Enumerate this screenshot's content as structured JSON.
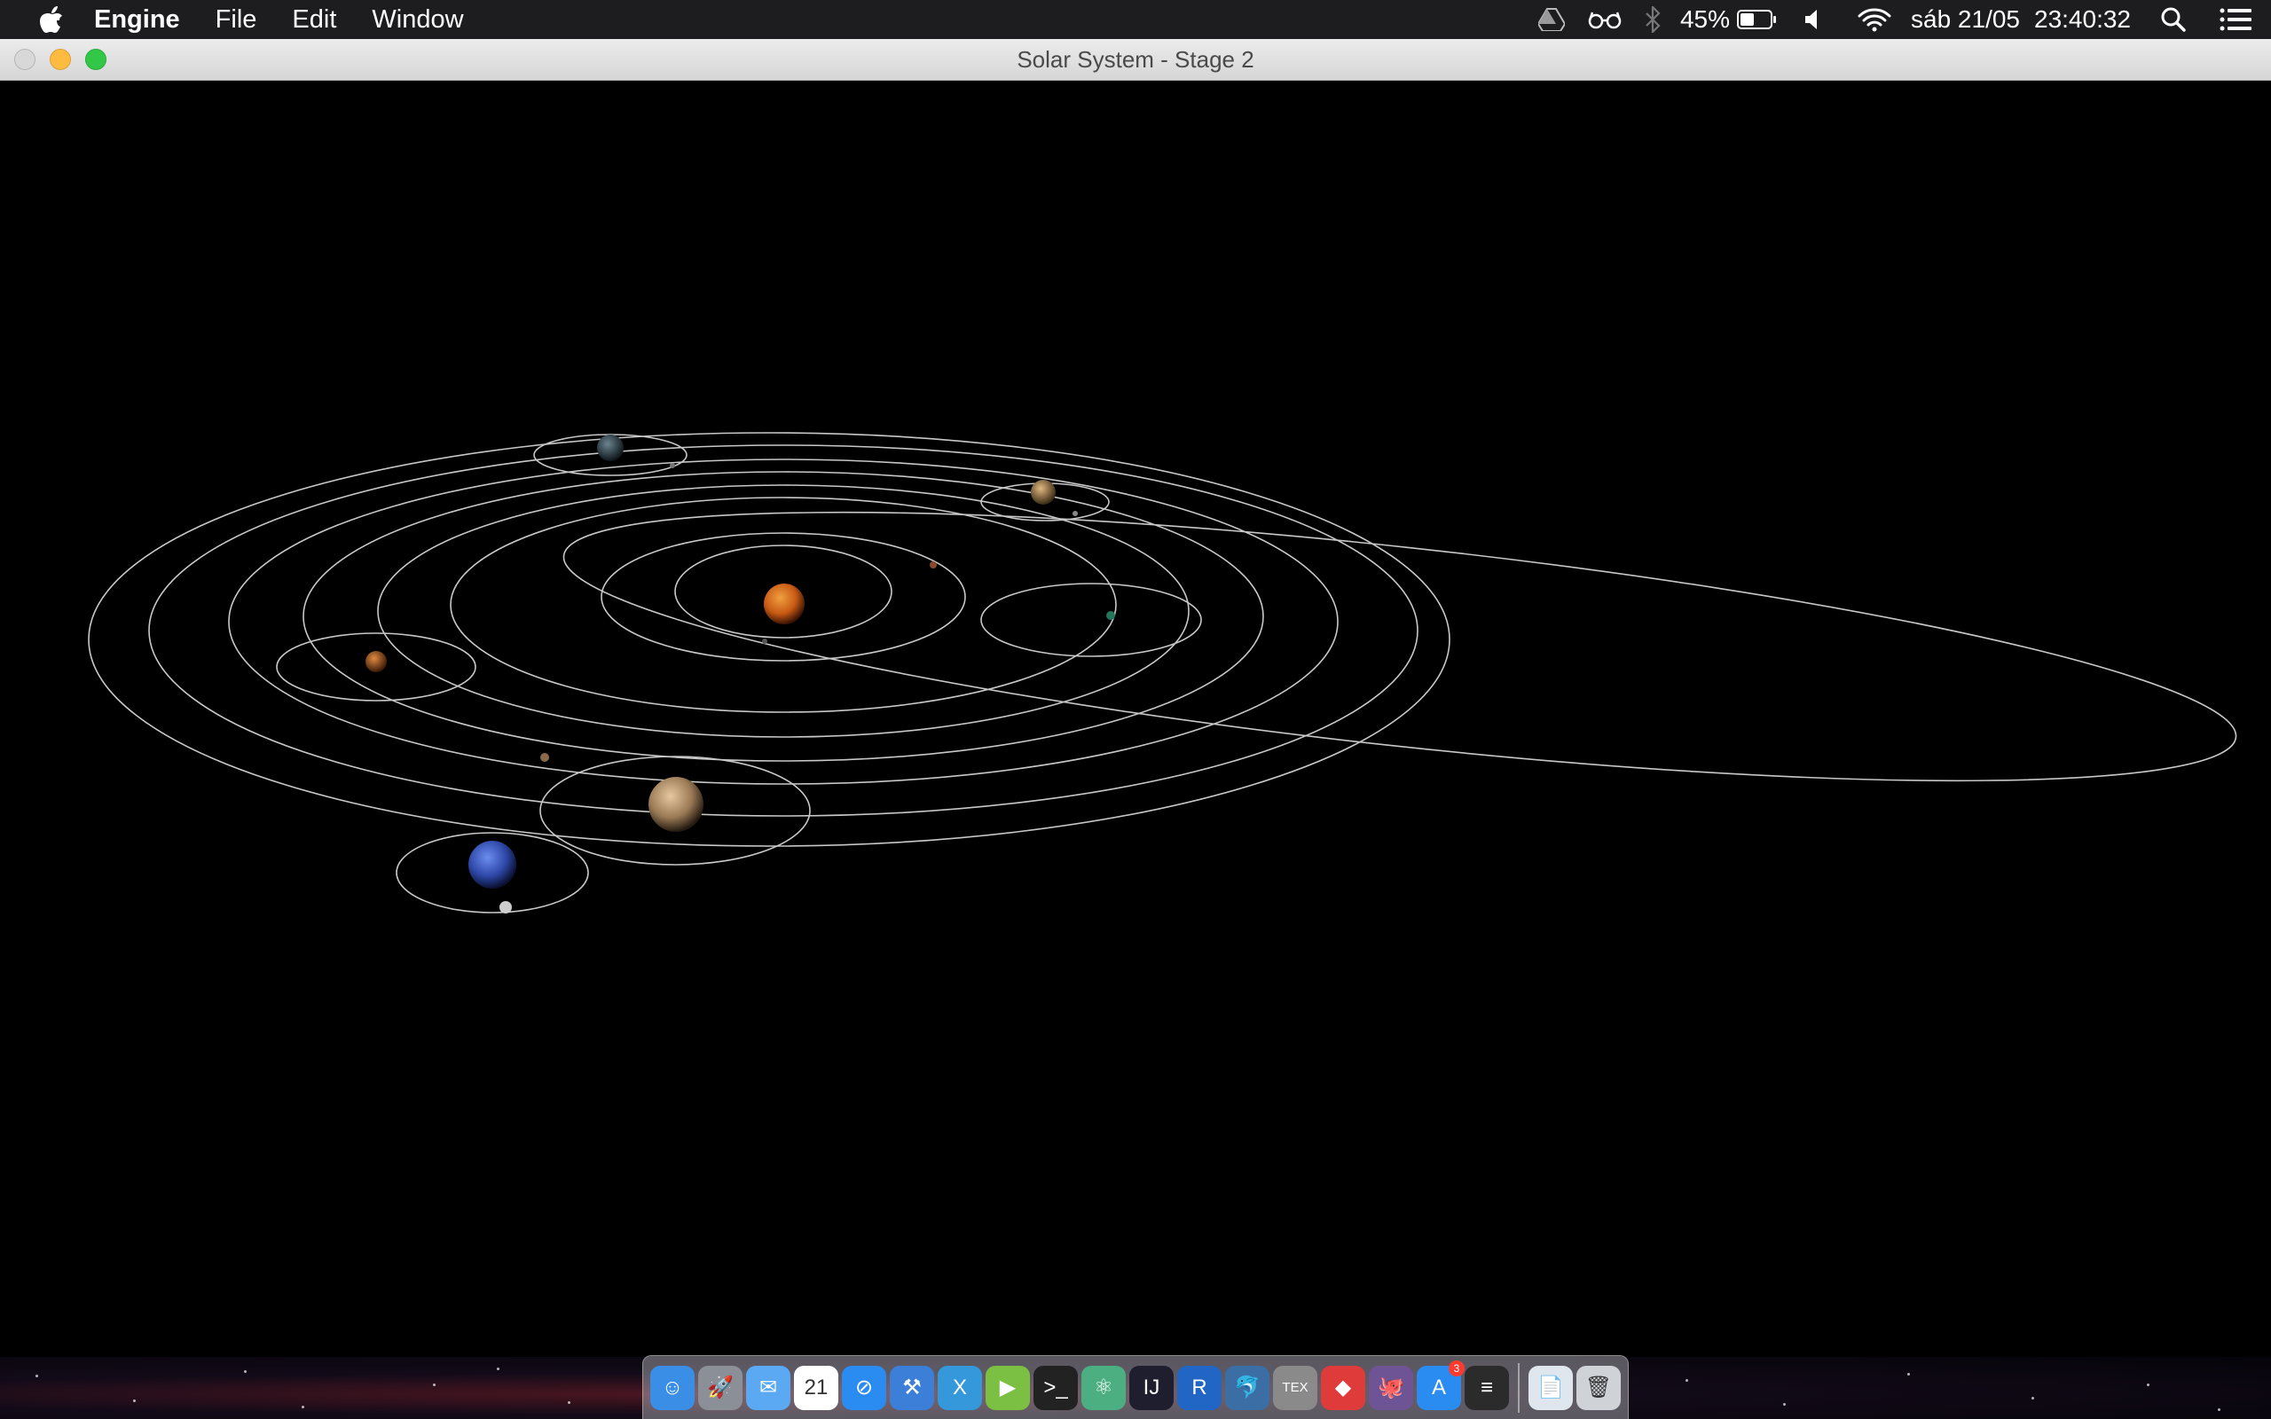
{
  "menubar": {
    "app_name": "Engine",
    "menus": [
      "File",
      "Edit",
      "Window"
    ],
    "status": {
      "battery": "45%",
      "date": "sáb 21/05",
      "time": "23:40:32"
    }
  },
  "window": {
    "title": "Solar System - Stage 2"
  },
  "dock": {
    "items": [
      {
        "name": "finder-icon",
        "color": "#3a8ee6",
        "glyph": "☺"
      },
      {
        "name": "launchpad-icon",
        "color": "#8a8f98",
        "glyph": "🚀"
      },
      {
        "name": "mail-icon",
        "color": "#5aa9f2",
        "glyph": "✉"
      },
      {
        "name": "calendar-icon",
        "color": "#ffffff",
        "glyph": "21"
      },
      {
        "name": "safari-icon",
        "color": "#2a8cf0",
        "glyph": "⊘"
      },
      {
        "name": "xcode-instruments-icon",
        "color": "#3b7fd8",
        "glyph": "⚒"
      },
      {
        "name": "xamarin-icon",
        "color": "#3498db",
        "glyph": "X"
      },
      {
        "name": "infuse-icon",
        "color": "#7bc043",
        "glyph": "▶"
      },
      {
        "name": "terminal-icon",
        "color": "#222222",
        "glyph": ">_"
      },
      {
        "name": "atom-icon",
        "color": "#4caf82",
        "glyph": "⚛"
      },
      {
        "name": "intellij-icon",
        "color": "#1e1e2e",
        "glyph": "IJ"
      },
      {
        "name": "r-icon",
        "color": "#2166c4",
        "glyph": "R"
      },
      {
        "name": "mysql-workbench-icon",
        "color": "#3c6ea6",
        "glyph": "🐬"
      },
      {
        "name": "tex-icon",
        "color": "#8a8a8a",
        "glyph": "TEX"
      },
      {
        "name": "git-icon",
        "color": "#e03b3b",
        "glyph": "◆"
      },
      {
        "name": "github-icon",
        "color": "#6e5494",
        "glyph": "🐙"
      },
      {
        "name": "app-store-icon",
        "color": "#2a8cf0",
        "glyph": "A",
        "badge": "3"
      },
      {
        "name": "console-icon",
        "color": "#2b2b2b",
        "glyph": "≡"
      }
    ],
    "right_items": [
      {
        "name": "document-preview-icon",
        "color": "#dfe6ee",
        "glyph": "📄"
      },
      {
        "name": "trash-icon",
        "color": "#cfd3d8",
        "glyph": "🗑"
      }
    ]
  },
  "colors": {
    "orbit": "#c8c8c8",
    "sun": "#d9661a",
    "saturn": "#c9a57a",
    "neptune": "#3f5fc8",
    "mars": "#b5621f",
    "venus": "#b08a55",
    "uranus": "#35444c",
    "moon": "#cccccc",
    "earth_like": "#23755e"
  }
}
